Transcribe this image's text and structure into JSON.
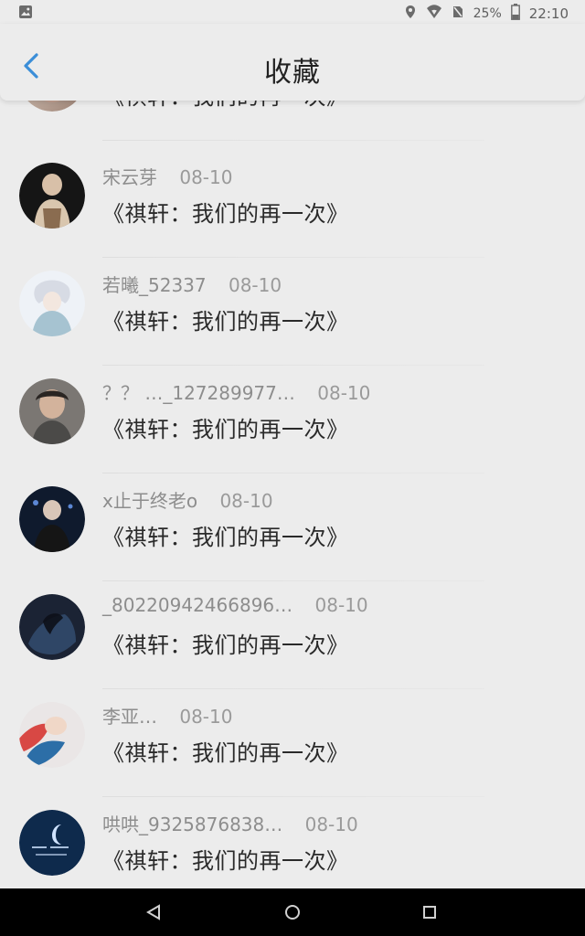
{
  "status_bar": {
    "battery_percent": "25%",
    "time": "22:10",
    "icons": [
      "gallery-icon",
      "location-icon",
      "wifi-icon",
      "no-sim-icon",
      "battery-icon"
    ]
  },
  "app_bar": {
    "title": "收藏",
    "back_icon": "chevron-left-icon"
  },
  "comments": [
    {
      "name": "",
      "date": "",
      "text": "《祺轩：我们的再一次》",
      "avatar_colors": [
        "#d8c7b7",
        "#a0887a"
      ]
    },
    {
      "name": "宋云芽",
      "date": "08-10",
      "text": "《祺轩：我们的再一次》",
      "avatar_colors": [
        "#1b1b1b",
        "#a08a6f"
      ]
    },
    {
      "name": "若曦_52337",
      "date": "08-10",
      "text": "《祺轩：我们的再一次》",
      "avatar_colors": [
        "#e9eef5",
        "#9eb6c5"
      ]
    },
    {
      "name": "？？ …_127289977…",
      "date": "08-10",
      "text": "《祺轩：我们的再一次》",
      "avatar_colors": [
        "#6d6a66",
        "#c8b6a6"
      ]
    },
    {
      "name": "x止于终老o",
      "date": "08-10",
      "text": "《祺轩：我们的再一次》",
      "avatar_colors": [
        "#0f1a2d",
        "#2f4466"
      ]
    },
    {
      "name": "_80220942466896…",
      "date": "08-10",
      "text": "《祺轩：我们的再一次》",
      "avatar_colors": [
        "#1a2233",
        "#324763"
      ]
    },
    {
      "name": "李亚…",
      "date": "08-10",
      "text": "《祺轩：我们的再一次》",
      "avatar_colors": [
        "#e44c46",
        "#2c6ea7"
      ]
    },
    {
      "name": "哄哄_9325876838…",
      "date": "08-10",
      "text": "《祺轩：我们的再一次》",
      "avatar_colors": [
        "#0e2a4c",
        "#1f4c74"
      ]
    }
  ],
  "nav_bar": {
    "icons": [
      "back-triangle-icon",
      "home-circle-icon",
      "recents-square-icon"
    ]
  },
  "colors": {
    "background": "#ececec",
    "accent_blue": "#3b8ed8",
    "navbar": "#000000"
  }
}
